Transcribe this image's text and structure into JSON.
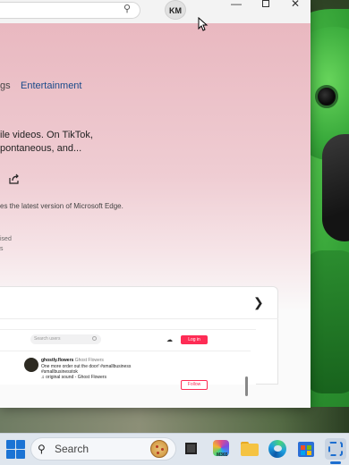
{
  "browser": {
    "profile_initials": "KM",
    "window_controls": {
      "minimize": "—",
      "maximize": "",
      "close": "✕"
    }
  },
  "page": {
    "category_partial": "gs",
    "category_entertainment": "Entertainment",
    "description_line1": "ile videos. On TikTok,",
    "description_line2": "pontaneous, and...",
    "edge_note": "es the latest version of Microsoft Edge.",
    "small_line_a": "ised",
    "small_line_b": "s"
  },
  "preview": {
    "search_placeholder": "Search users",
    "login_label": "Log in",
    "username": "ghostly.flowers",
    "display_name": "Ghost Flowers",
    "caption_line1": "One more order out the door! #smallbusiness",
    "caption_line2": "#smallbusinesstok",
    "music": "♫ original sound - Ghost Flowers",
    "follow_label": "Follow"
  },
  "taskbar": {
    "search_label": "Search",
    "m365_label": "M365"
  },
  "icons": {
    "search": "search-icon",
    "share": "share-icon",
    "chevron": "chevron-right-icon",
    "upload": "cloud-upload-icon"
  }
}
